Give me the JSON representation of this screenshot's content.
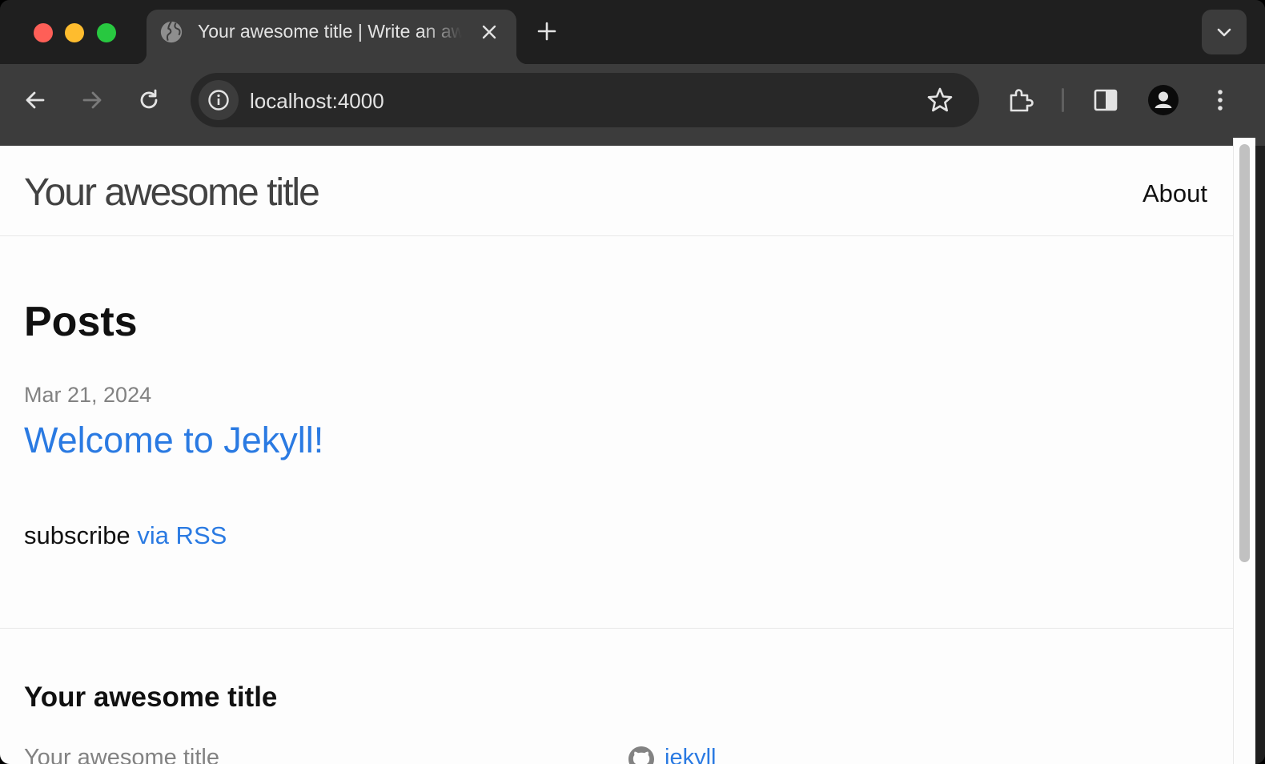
{
  "browser": {
    "tab": {
      "title": "Your awesome title | Write an awesome description for your new site here."
    },
    "address_bar": {
      "url": "localhost:4000"
    }
  },
  "page": {
    "site_title": "Your awesome title",
    "nav": {
      "about": "About"
    },
    "posts_heading": "Posts",
    "posts": [
      {
        "date": "Mar 21, 2024",
        "title": "Welcome to Jekyll!"
      }
    ],
    "subscribe": {
      "text": "subscribe",
      "link": "via RSS"
    },
    "footer": {
      "title": "Your awesome title",
      "col1": "Your awesome title",
      "github": "jekyll"
    }
  },
  "colors": {
    "link": "#2a7ae2",
    "meta": "#828282",
    "text": "#111111"
  },
  "icons": [
    "globe-icon",
    "close-icon",
    "plus-icon",
    "chevron-down-icon",
    "back-icon",
    "forward-icon",
    "reload-icon",
    "info-icon",
    "star-icon",
    "extensions-icon",
    "side-panel-icon",
    "profile-icon",
    "more-vert-icon",
    "github-icon"
  ]
}
